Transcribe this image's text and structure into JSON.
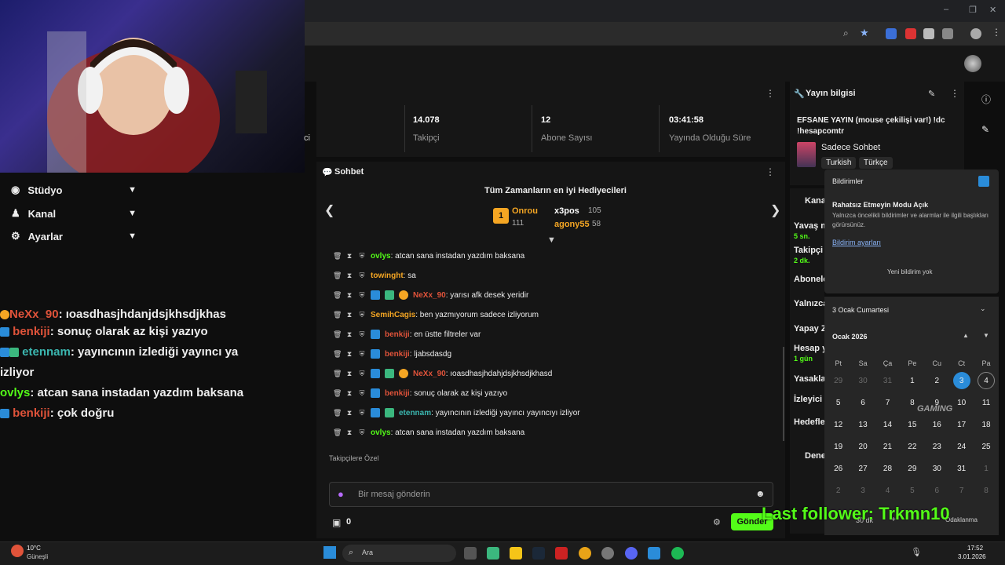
{
  "browser": {
    "controls": [
      "–",
      "❐",
      "✕"
    ]
  },
  "left_nav": {
    "items": [
      {
        "label": "Stüdyo"
      },
      {
        "label": "Kanal"
      },
      {
        "label": "Ayarlar"
      }
    ]
  },
  "overlay_chat": [
    {
      "user": "NeXx_90",
      "text": ": ıoasdhasjhdanjdsjkhsdjkhas",
      "color": "#e0533a"
    },
    {
      "user": "benkiji",
      "text": ": sonuç olarak az kişi yazıyo",
      "color": "#e0533a"
    },
    {
      "user": "etennam",
      "text": ": yayıncının izlediği yayıncı ya",
      "color": "#3bb7b0"
    },
    {
      "user": "",
      "text": "izliyor",
      "color": "#fff"
    },
    {
      "user": "ovlys",
      "text": ": atcan sana instadan yazdım baksana",
      "color": "#53fc18"
    },
    {
      "user": "benkiji",
      "text": ": çok doğru",
      "color": "#e0533a"
    }
  ],
  "stats": {
    "left_partial": "ci",
    "followers_value": "14.078",
    "followers_label": "Takipçi",
    "subs_value": "12",
    "subs_label": "Abone Sayısı",
    "uptime_value": "03:41:58",
    "uptime_label": "Yayında Olduğu Süre"
  },
  "chat": {
    "title": "Sohbet",
    "gifters_title": "Tüm Zamanların en iyi Hediyecileri",
    "gifters": [
      {
        "name": "Onrou",
        "count": "111"
      },
      {
        "name": "x3pos",
        "count": "105"
      },
      {
        "name": "agony55",
        "count": "58"
      }
    ],
    "messages": [
      {
        "user": "ovlys",
        "color": "#53fc18",
        "text": ": atcan sana instadan yazdım baksana",
        "badges": 0
      },
      {
        "user": "towinght",
        "color": "#f5a623",
        "text": ": sa",
        "badges": 0
      },
      {
        "user": "NeXx_90",
        "color": "#e0533a",
        "text": ": yarısı afk desek yeridir",
        "badges": 3
      },
      {
        "user": "SemihCagis",
        "color": "#f5a623",
        "text": ": ben yazmıyorum sadece izliyorum",
        "badges": 0
      },
      {
        "user": "benkiji",
        "color": "#e0533a",
        "text": ": en üstte filtreler var",
        "badges": 1
      },
      {
        "user": "benkiji",
        "color": "#e0533a",
        "text": ": ljabsdasdg",
        "badges": 1
      },
      {
        "user": "NeXx_90",
        "color": "#e0533a",
        "text": ": ıoasdhasjhdahjdsjkhsdjkhasd",
        "badges": 3
      },
      {
        "user": "benkiji",
        "color": "#e0533a",
        "text": ": sonuç olarak az kişi yazıyo",
        "badges": 1
      },
      {
        "user": "etennam",
        "color": "#3bb7b0",
        "text": ": yayıncının izlediği yayıncı yayıncıyı izliyor",
        "badges": 2
      },
      {
        "user": "ovlys",
        "color": "#53fc18",
        "text": ": atcan sana instadan yazdım baksana",
        "badges": 0
      }
    ],
    "followers_only": "Takipçilere Özel",
    "input_placeholder": "Bir mesaj gönderin",
    "points": "0",
    "send_label": "Gönder"
  },
  "stream_info": {
    "title": "Yayın bilgisi",
    "stream_title": "EFSANE YAYIN (mouse çekilişi var!) !dc !hesapcomtr",
    "category": "Sadece Sohbet",
    "tags": [
      "Turkish",
      "Türkçe"
    ]
  },
  "channel_ctrl": {
    "header": "Kana",
    "rows": [
      {
        "label": "Yavaş m",
        "sub": "5 sn."
      },
      {
        "label": "Takipçi",
        "sub": "2 dk."
      },
      {
        "label": "Abonele",
        "sub": ""
      },
      {
        "label": "Yalnızca",
        "sub": ""
      },
      {
        "label": "Yapay Z",
        "sub": ""
      },
      {
        "label": "Hesap y",
        "sub": "1 gün"
      },
      {
        "label": "Yasakla",
        "sub": ""
      },
      {
        "label": "İzleyici",
        "sub": ""
      },
      {
        "label": "Hedefle",
        "sub": ""
      }
    ],
    "bottom": "Dene"
  },
  "notifications": {
    "title": "Bildirimler",
    "dnd_title": "Rahatsız Etmeyin Modu Açık",
    "dnd_body": "Yalnızca öncelikli bildirimler ve alarmlar ile ilgili başlıkları görürsünüz.",
    "settings_link": "Bildirim ayarları",
    "empty": "Yeni bildirim yok"
  },
  "calendar": {
    "date_header": "3 Ocak Cumartesi",
    "month": "Ocak 2026",
    "weekdays": [
      "Pt",
      "Sa",
      "Ça",
      "Pe",
      "Cu",
      "Ct",
      "Pa"
    ],
    "days": [
      [
        "29",
        "30",
        "31",
        "1",
        "2",
        "3",
        "4"
      ],
      [
        "5",
        "6",
        "7",
        "8",
        "9",
        "10",
        "11"
      ],
      [
        "12",
        "13",
        "14",
        "15",
        "16",
        "17",
        "18"
      ],
      [
        "19",
        "20",
        "21",
        "22",
        "23",
        "24",
        "25"
      ],
      [
        "26",
        "27",
        "28",
        "29",
        "30",
        "31",
        "1"
      ],
      [
        "2",
        "3",
        "4",
        "5",
        "6",
        "7",
        "8"
      ]
    ],
    "focus_minutes": "30 dk",
    "focus_label": "Odaklanma"
  },
  "overlay": {
    "last_follower": "Last follower: Trkmn10"
  },
  "watermark": "GAMING",
  "taskbar": {
    "weather_temp": "10°C",
    "weather_desc": "Güneşli",
    "search": "Ara",
    "time": "17:52",
    "date": "3.01.2026"
  },
  "colors": {
    "kick_green": "#53fc18",
    "accent_blue": "#2a8cd9"
  }
}
